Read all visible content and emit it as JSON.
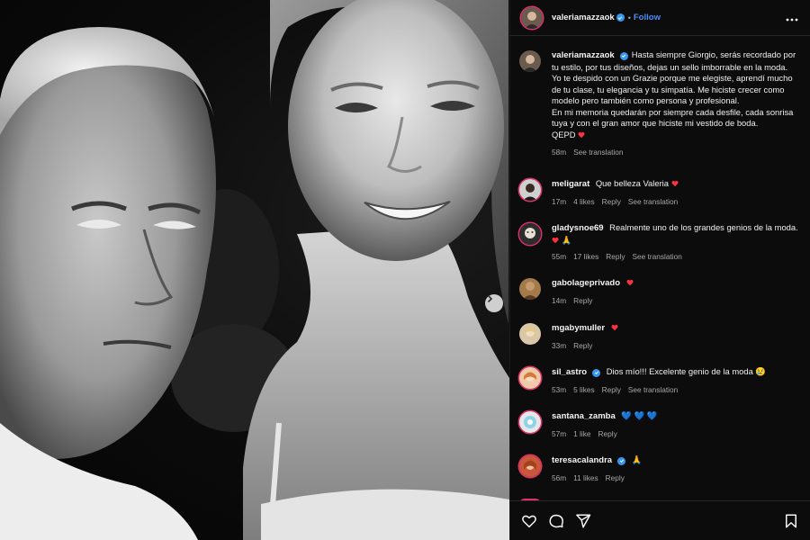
{
  "post": {
    "author": "valeriamazzaok",
    "follow_label": "Follow",
    "dot": "•",
    "caption": "Hasta siempre Giorgio, serás recordado por tu estilo, por tus diseños, dejas un sello imborrable en la moda. Yo te despido con un Grazie porque me elegiste, aprendí mucho de tu clase, tu elegancia y tu simpatía. Me hiciste crecer como modelo pero también como persona y profesional.",
    "caption_2": "En mi memoria quedarán por siempre cada desfile, cada sonrisa tuya y con el gran amor que hiciste mi vestido de boda.",
    "caption_3": "QEPD",
    "time": "58m",
    "see_translation": "See translation"
  },
  "labels": {
    "reply": "Reply",
    "see_translation": "See translation"
  },
  "comments": [
    {
      "user": "meligarat",
      "text": "Que belleza Valeria",
      "time": "17m",
      "likes": "4 likes",
      "translation": true,
      "heart": true,
      "emoji": ""
    },
    {
      "user": "gladysnoe69",
      "text": "Realmente uno de los grandes genios de la moda.",
      "time": "55m",
      "likes": "17 likes",
      "translation": true,
      "heart": true,
      "emoji": "🙏"
    },
    {
      "user": "gabolageprivado",
      "text": "",
      "time": "14m",
      "likes": "",
      "translation": false,
      "heart": true,
      "emoji": ""
    },
    {
      "user": "mgabymuller",
      "text": "",
      "time": "33m",
      "likes": "",
      "translation": false,
      "heart": true,
      "emoji": ""
    },
    {
      "user": "sil_astro",
      "text": "Dios mío!!! Excelente genio de la moda",
      "time": "53m",
      "likes": "5 likes",
      "translation": true,
      "heart": false,
      "emoji": "😢",
      "verified": true
    },
    {
      "user": "santana_zamba",
      "text": "💙 💙 💙",
      "time": "57m",
      "likes": "1 like",
      "translation": false,
      "heart": false,
      "emoji": ""
    },
    {
      "user": "teresacalandra",
      "text": "🙏",
      "time": "56m",
      "likes": "11 likes",
      "translation": false,
      "heart": false,
      "emoji": "",
      "verified": true
    }
  ],
  "colors": {
    "background": "#0c0c0c",
    "follow": "#4c8ef7",
    "verified": "#3897f0",
    "heart": "#ff3040",
    "muted": "#a8a8a8"
  },
  "icons": {
    "like": "heart-icon",
    "comment": "comment-icon",
    "share": "share-icon",
    "save": "bookmark-icon",
    "next": "chevron-right-icon"
  }
}
